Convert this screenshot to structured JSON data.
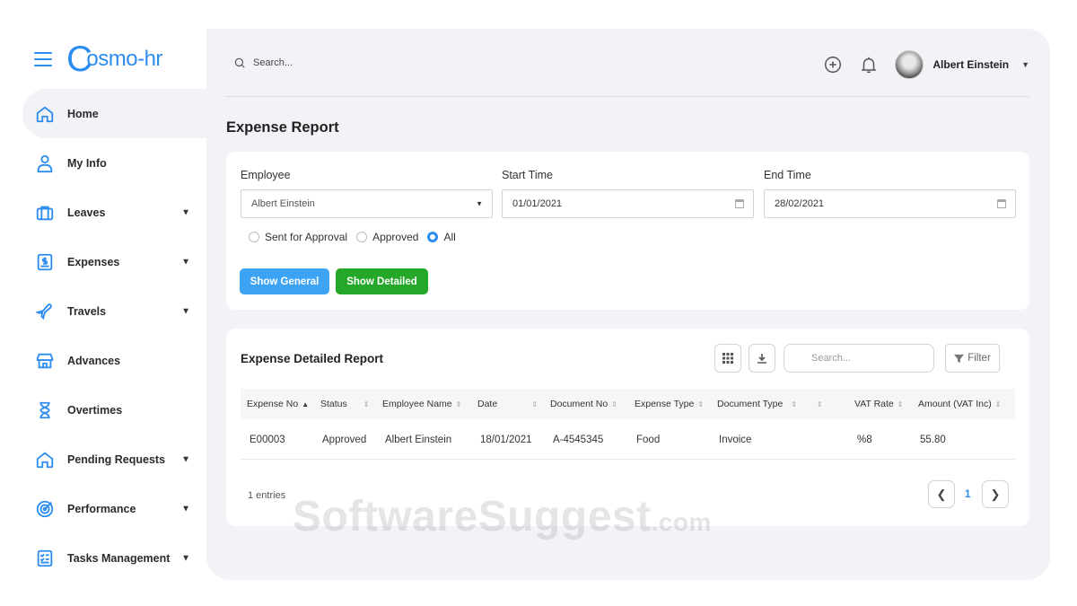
{
  "brand": {
    "logo": "osmo-hr",
    "logo_initial": "C"
  },
  "sidebar": {
    "items": [
      {
        "label": "Home",
        "icon": "home-icon",
        "active": true,
        "has_submenu": false
      },
      {
        "label": "My Info",
        "icon": "user-icon",
        "has_submenu": false
      },
      {
        "label": "Leaves",
        "icon": "briefcase-icon",
        "has_submenu": true
      },
      {
        "label": "Expenses",
        "icon": "expense-icon",
        "has_submenu": true
      },
      {
        "label": "Travels",
        "icon": "airplane-icon",
        "has_submenu": true
      },
      {
        "label": "Advances",
        "icon": "store-icon",
        "has_submenu": false
      },
      {
        "label": "Overtimes",
        "icon": "hourglass-icon",
        "has_submenu": false
      },
      {
        "label": "Pending Requests",
        "icon": "home-outline-icon",
        "has_submenu": true
      },
      {
        "label": "Performance",
        "icon": "target-icon",
        "has_submenu": true
      },
      {
        "label": "Tasks Management",
        "icon": "checklist-icon",
        "has_submenu": true
      }
    ]
  },
  "topbar": {
    "search_placeholder": "Search...",
    "user_name": "Albert Einstein"
  },
  "page": {
    "title": "Expense Report"
  },
  "filters": {
    "employee_label": "Employee",
    "employee_value": "Albert Einstein",
    "start_label": "Start Time",
    "start_value": "01/01/2021",
    "end_label": "End Time",
    "end_value": "28/02/2021",
    "radios": [
      {
        "label": "Sent for Approval",
        "checked": false
      },
      {
        "label": "Approved",
        "checked": false
      },
      {
        "label": "All",
        "checked": true
      }
    ],
    "show_general": "Show General",
    "show_detailed": "Show Detailed"
  },
  "report": {
    "title": "Expense Detailed Report",
    "search_placeholder": "Search...",
    "filter_label": "Filter",
    "columns": [
      "Expense No",
      "Status",
      "Employee Name",
      "Date",
      "Document No",
      "Expense Type",
      "Document Type",
      "",
      "VAT Rate",
      "Amount (VAT Inc)"
    ],
    "rows": [
      [
        "E00003",
        "Approved",
        "Albert Einstein",
        "18/01/2021",
        "A-4545345",
        "Food",
        "Invoice",
        "",
        "%8",
        "55.80"
      ]
    ],
    "entries": "1 entries",
    "current_page": "1"
  },
  "watermark": {
    "main": "SoftwareSuggest",
    "suffix": ".com"
  },
  "colors": {
    "accent": "#2d8cf0",
    "success": "#25a82a",
    "info": "#3da4f5",
    "panel": "#f1f3f7"
  }
}
